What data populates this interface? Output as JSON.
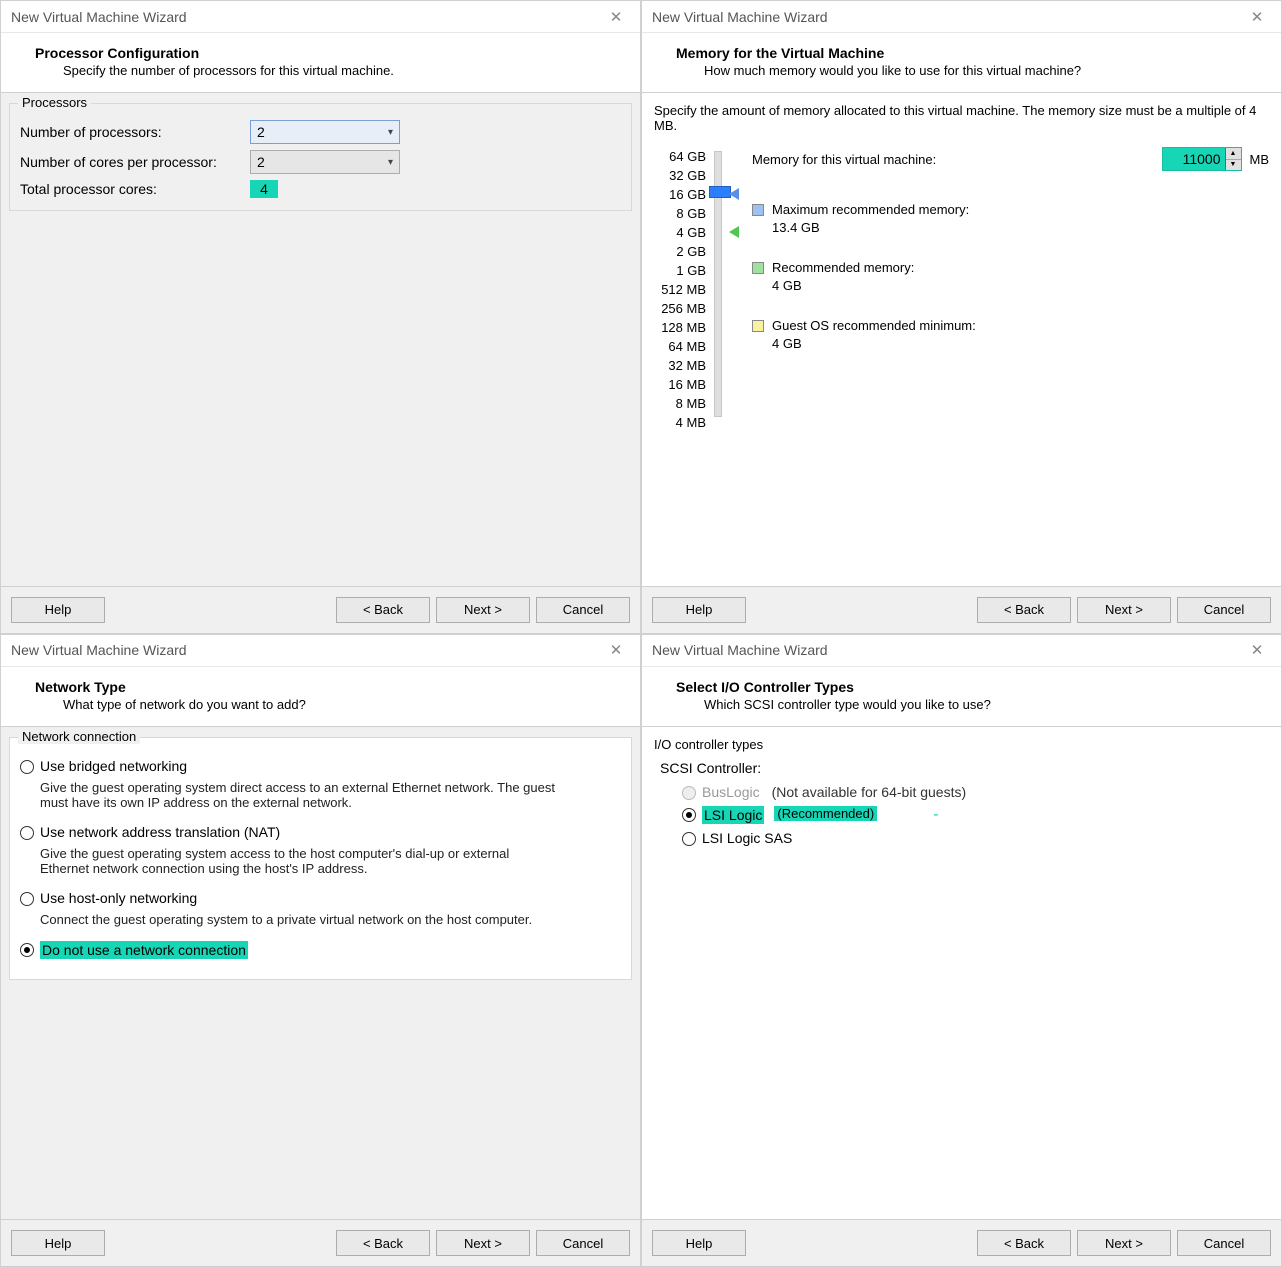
{
  "common": {
    "wizard_title": "New Virtual Machine Wizard",
    "help": "Help",
    "back": "< Back",
    "next": "Next >",
    "cancel": "Cancel"
  },
  "proc": {
    "title": "Processor Configuration",
    "sub": "Specify the number of processors for this virtual machine.",
    "group": "Processors",
    "num_proc_label": "Number of processors:",
    "num_proc_value": "2",
    "cores_label": "Number of cores per processor:",
    "cores_value": "2",
    "total_label": "Total processor cores:",
    "total_value": "4"
  },
  "mem": {
    "title": "Memory for the Virtual Machine",
    "sub": "How much memory would you like to use for this virtual machine?",
    "desc": "Specify the amount of memory allocated to this virtual machine. The memory size must be a multiple of 4 MB.",
    "input_label": "Memory for this virtual machine:",
    "input_value": "11000",
    "input_unit": "MB",
    "ticks": [
      "64 GB",
      "32 GB",
      "16 GB",
      "8 GB",
      "4 GB",
      "2 GB",
      "1 GB",
      "512 MB",
      "256 MB",
      "128 MB",
      "64 MB",
      "32 MB",
      "16 MB",
      "8 MB",
      "4 MB"
    ],
    "max_label": "Maximum recommended memory:",
    "max_value": "13.4 GB",
    "rec_label": "Recommended memory:",
    "rec_value": "4 GB",
    "min_label": "Guest OS recommended minimum:",
    "min_value": "4 GB"
  },
  "net": {
    "title": "Network Type",
    "sub": "What type of network do you want to add?",
    "group": "Network connection",
    "opt1": "Use bridged networking",
    "opt1d": "Give the guest operating system direct access to an external Ethernet network. The guest must have its own IP address on the external network.",
    "opt2": "Use network address translation (NAT)",
    "opt2d": "Give the guest operating system access to the host computer's dial-up or external Ethernet network connection using the host's IP address.",
    "opt3": "Use host-only networking",
    "opt3d": "Connect the guest operating system to a private virtual network on the host computer.",
    "opt4": "Do not use a network connection"
  },
  "io": {
    "title": "Select I/O Controller Types",
    "sub": "Which SCSI controller type would you like to use?",
    "group": "I/O controller types",
    "scsi_label": "SCSI Controller:",
    "opt1": "BusLogic",
    "opt1_note": "(Not available for 64-bit guests)",
    "opt2": "LSI Logic",
    "opt2_note": "(Recommended)",
    "opt2_dash": "-",
    "opt3": "LSI Logic SAS"
  }
}
